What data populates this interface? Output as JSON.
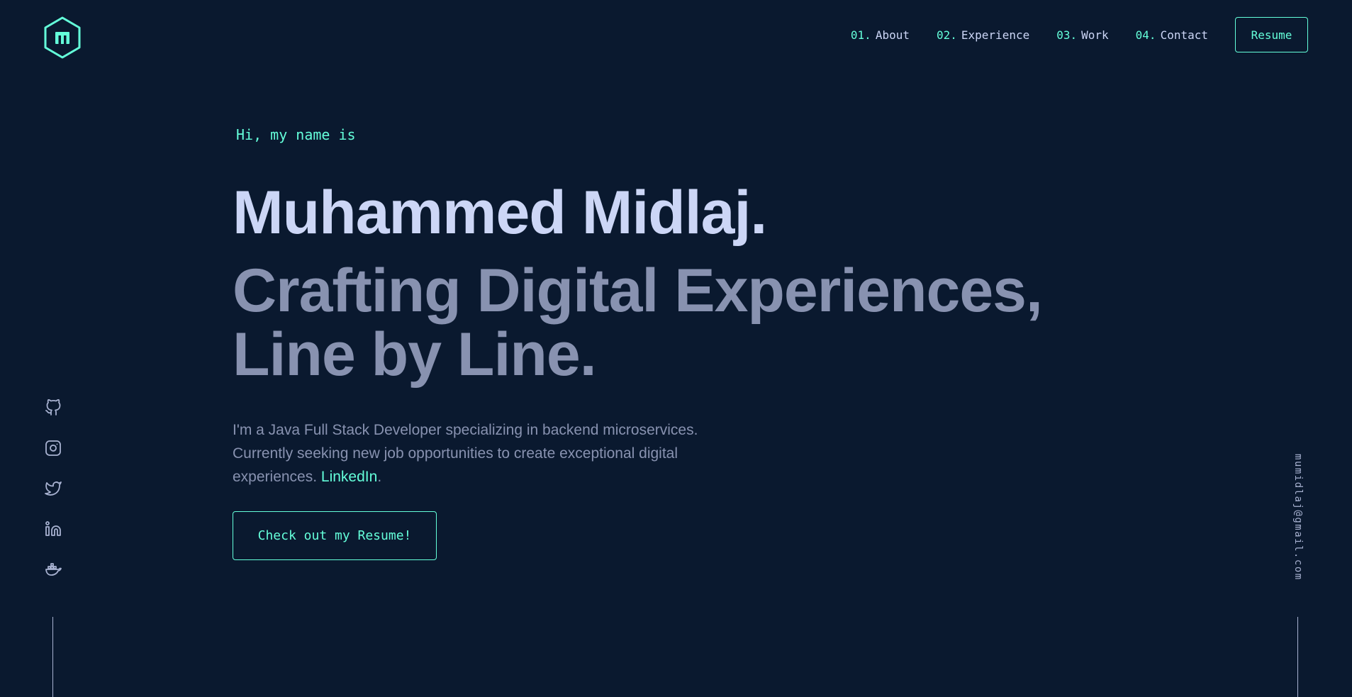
{
  "header": {
    "logo_letter": "m",
    "logo_icon": "hexagon-m-logo-icon",
    "nav": [
      {
        "num": "01.",
        "label": "About"
      },
      {
        "num": "02.",
        "label": "Experience"
      },
      {
        "num": "03.",
        "label": "Work"
      },
      {
        "num": "04.",
        "label": "Contact"
      }
    ],
    "resume_label": "Resume"
  },
  "hero": {
    "greeting": "Hi, my name is",
    "name": "Muhammed Midlaj.",
    "tagline_line1": "Crafting Digital Experiences,",
    "tagline_line2": "Line by Line.",
    "description": "I'm a Java Full Stack Developer specializing in backend microservices. Currently seeking new job opportunities to create exceptional digital experiences. ",
    "link_label": "LinkedIn",
    "trailing": ".",
    "cta_label": "Check out my Resume!"
  },
  "socials": [
    "github-icon",
    "instagram-icon",
    "twitter-icon",
    "linkedin-icon",
    "docker-icon"
  ],
  "email": "mumidlaj@gmail.com",
  "colors": {
    "background": "#0a192f",
    "accent": "#64ffda",
    "lightest_slate": "#ccd6f6",
    "slate": "#8892b0",
    "light_slate": "#a8b2d1"
  }
}
